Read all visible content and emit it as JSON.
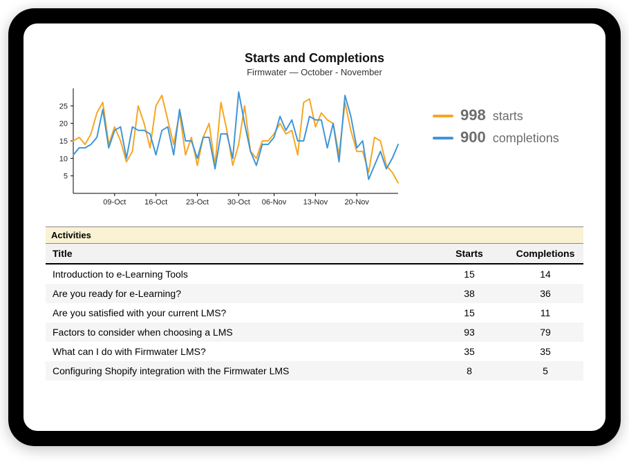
{
  "chart": {
    "title": "Starts and Completions",
    "subtitle": "Firmwater — October - November"
  },
  "legend": {
    "starts_value": "998",
    "starts_label": "starts",
    "completions_value": "900",
    "completions_label": "completions"
  },
  "colors": {
    "starts": "#f5a623",
    "completions": "#3f95d6"
  },
  "activities": {
    "banner": "Activities",
    "headers": {
      "title": "Title",
      "starts": "Starts",
      "completions": "Completions"
    },
    "rows": [
      {
        "title": "Introduction to e-Learning Tools",
        "starts": "15",
        "completions": "14"
      },
      {
        "title": "Are you ready for e-Learning?",
        "starts": "38",
        "completions": "36"
      },
      {
        "title": "Are you satisfied with your current LMS?",
        "starts": "15",
        "completions": "11"
      },
      {
        "title": "Factors to consider when choosing a LMS",
        "starts": "93",
        "completions": "79"
      },
      {
        "title": "What can I do with Firmwater LMS?",
        "starts": "35",
        "completions": "35"
      },
      {
        "title": "Configuring Shopify integration with the Firmwater LMS",
        "starts": "8",
        "completions": "5"
      }
    ]
  },
  "chart_data": {
    "type": "line",
    "title": "Starts and Completions",
    "xlabel": "",
    "ylabel": "",
    "ylim": [
      0,
      30
    ],
    "y_ticks": [
      5,
      10,
      15,
      20,
      25
    ],
    "x_tick_labels": [
      "09-Oct",
      "16-Oct",
      "23-Oct",
      "30-Oct",
      "06-Nov",
      "13-Nov",
      "20-Nov"
    ],
    "series": [
      {
        "name": "starts",
        "color": "#f5a623",
        "values": [
          15,
          16,
          14,
          17,
          23,
          26,
          14,
          19,
          15,
          9,
          12,
          25,
          20,
          13,
          25,
          28,
          21,
          14,
          23,
          11,
          16,
          8,
          16,
          20,
          8,
          26,
          18,
          8,
          14,
          25,
          12,
          10,
          15,
          15,
          17,
          20,
          17,
          18,
          11,
          26,
          27,
          19,
          23,
          21,
          20,
          11,
          26,
          18,
          12,
          12,
          6,
          16,
          15,
          8,
          6,
          3
        ]
      },
      {
        "name": "completions",
        "color": "#3f95d6",
        "values": [
          11,
          13,
          13,
          14,
          16,
          24,
          13,
          18,
          19,
          10,
          19,
          18,
          18,
          17,
          11,
          18,
          19,
          11,
          24,
          15,
          15,
          10,
          16,
          16,
          7,
          17,
          17,
          10,
          29,
          20,
          12,
          8,
          14,
          14,
          16,
          22,
          18,
          21,
          15,
          15,
          22,
          21,
          21,
          13,
          20,
          9,
          28,
          22,
          13,
          15,
          4,
          8,
          12,
          7,
          10,
          14
        ]
      }
    ]
  }
}
